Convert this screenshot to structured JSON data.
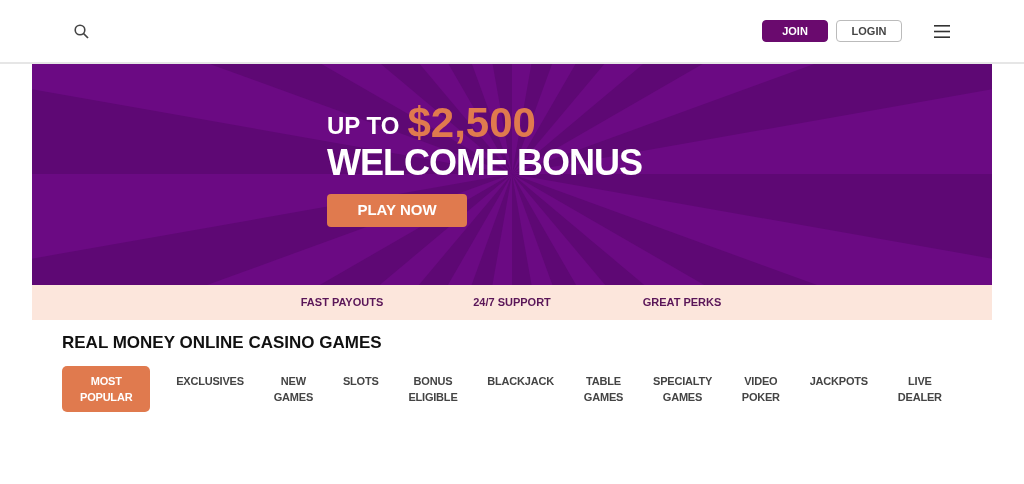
{
  "header": {
    "buttons": [
      {
        "label": "JOIN",
        "kind": "primary"
      },
      {
        "label": "LOGIN",
        "kind": "outline"
      }
    ]
  },
  "banner": {
    "lead": "UP TO",
    "amount": "$2,500",
    "headline": "WELCOME BONUS",
    "cta": "PLAY NOW"
  },
  "perks": [
    "FAST PAYOUTS",
    "24/7 SUPPORT",
    "GREAT PERKS"
  ],
  "section_title": "REAL MONEY ONLINE CASINO GAMES",
  "categories": [
    {
      "label": "MOST POPULAR",
      "selected": true
    },
    {
      "label": "EXCLUSIVES",
      "selected": false
    },
    {
      "label": "NEW GAMES",
      "selected": false
    },
    {
      "label": "SLOTS",
      "selected": false
    },
    {
      "label": "BONUS ELIGIBLE",
      "selected": false
    },
    {
      "label": "BLACKJACK",
      "selected": false
    },
    {
      "label": "TABLE GAMES",
      "selected": false
    },
    {
      "label": "SPECIALTY GAMES",
      "selected": false
    },
    {
      "label": "VIDEO POKER",
      "selected": false
    },
    {
      "label": "JACKPOTS",
      "selected": false
    },
    {
      "label": "LIVE DEALER",
      "selected": false
    }
  ]
}
